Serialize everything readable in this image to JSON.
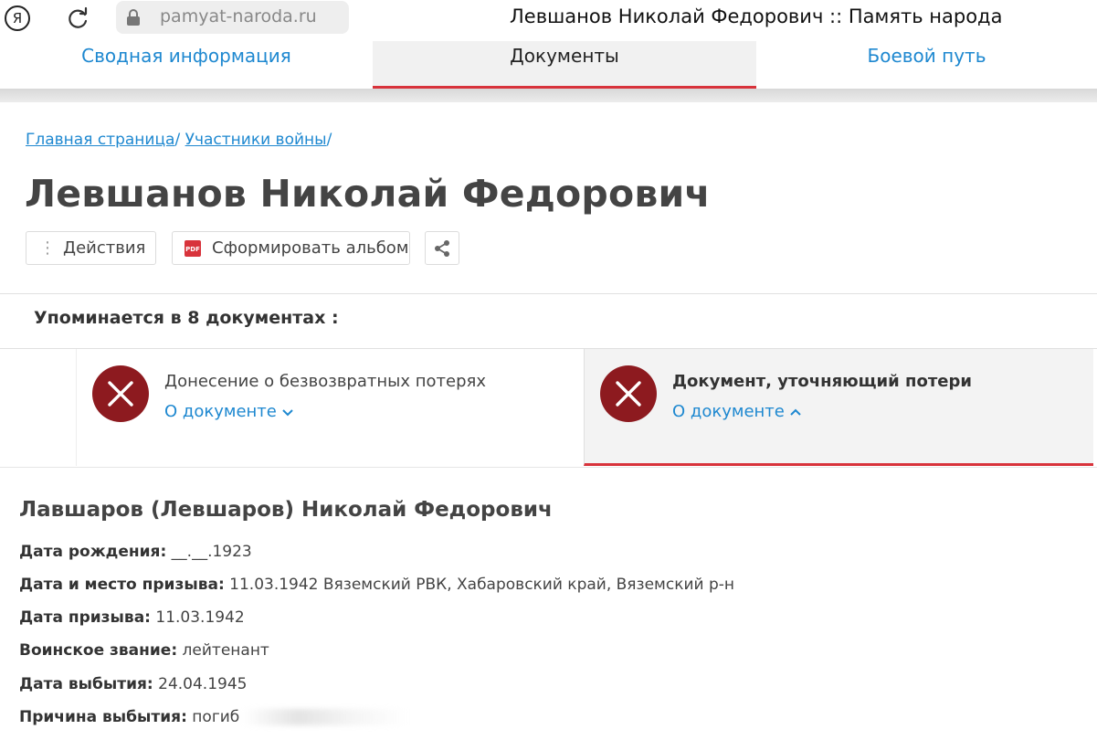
{
  "browser": {
    "logo_letter": "Я",
    "url": "pamyat-naroda.ru",
    "window_title": "Левшанов Николай Федорович :: Память народа"
  },
  "tabs": [
    {
      "label": "Сводная информация",
      "active": false
    },
    {
      "label": "Документы",
      "active": true
    },
    {
      "label": "Боевой путь",
      "active": false
    }
  ],
  "breadcrumb": {
    "items": [
      "Главная страница",
      "Участники войны"
    ],
    "separator": "/"
  },
  "page_title": "Левшанов Николай Федорович",
  "actions": {
    "actions_label": "Действия",
    "album_label": "Сформировать альбом",
    "pdf_icon_text": "PDF"
  },
  "mentions_text": "Упоминается в 8 документах :",
  "documents": [
    {
      "title": "Донесение о безвозвратных потерях",
      "link": "О документе",
      "expanded": false
    },
    {
      "title": "Документ, уточняющий потери",
      "link": "О документе",
      "expanded": true
    }
  ],
  "details": {
    "name": "Лавшаров (Левшаров) Николай Федорович",
    "rows": [
      {
        "key": "Дата рождения:",
        "value": "__.__.1923"
      },
      {
        "key": "Дата и место призыва:",
        "value": "11.03.1942 Вяземский РВК, Хабаровский край, Вяземский р-н"
      },
      {
        "key": "Дата призыва:",
        "value": "11.03.1942"
      },
      {
        "key": "Воинское звание:",
        "value": "лейтенант"
      },
      {
        "key": "Дата выбытия:",
        "value": "24.04.1945"
      },
      {
        "key": "Причина выбытия:",
        "value": "погиб"
      }
    ]
  },
  "colors": {
    "link_blue": "#1e88d0",
    "accent_red": "#d8333b",
    "icon_dark_red": "#8d1a1f"
  }
}
